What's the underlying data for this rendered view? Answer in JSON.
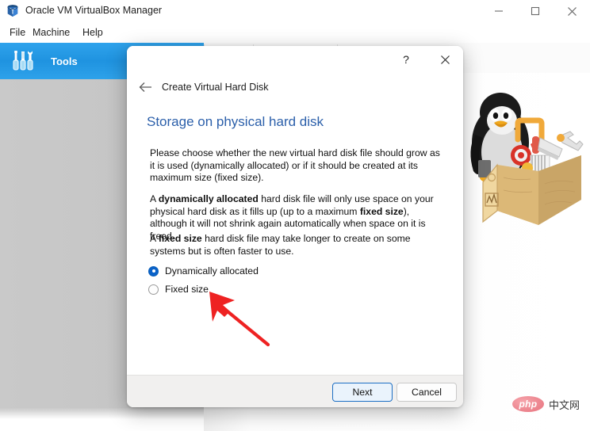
{
  "app": {
    "title": "Oracle VM VirtualBox Manager",
    "logo_icon": "virtualbox-cube-icon",
    "window_controls": {
      "minimize": "minimize-icon",
      "maximize": "maximize-icon",
      "close": "close-icon"
    },
    "menu": [
      {
        "label": "File"
      },
      {
        "label": "Machine"
      },
      {
        "label": "Help"
      }
    ],
    "sidebar": {
      "items": [
        {
          "label": "Tools",
          "icon": "tools-icon",
          "selected": true
        }
      ]
    },
    "toolbar": {
      "icons": [
        "swirl-icon",
        "orange-arc-icon",
        "blue-arc-icon",
        "gray-zigzag-icon",
        "green-square-icon"
      ]
    },
    "mascot": {
      "icon": "tux-penguin-toolbox-icon"
    }
  },
  "dialog": {
    "help_icon": "help-question-icon",
    "close_icon": "close-icon",
    "back_icon": "back-arrow-icon",
    "breadcrumb": "Create Virtual Hard Disk",
    "heading": "Storage on physical hard disk",
    "paragraphs": {
      "p1": "Please choose whether the new virtual hard disk file should grow as it is used (dynamically allocated) or if it should be created at its maximum size (fixed size).",
      "p2_pre": "A ",
      "p2_bold1": "dynamically allocated",
      "p2_mid": " hard disk file will only use space on your physical hard disk as it fills up (up to a maximum ",
      "p2_bold2": "fixed size",
      "p2_post": "), although it will not shrink again automatically when space on it is freed.",
      "p3_pre": "A ",
      "p3_bold": "fixed size",
      "p3_post": " hard disk file may take longer to create on some systems but is often faster to use."
    },
    "options": [
      {
        "label": "Dynamically allocated",
        "selected": true
      },
      {
        "label": "Fixed size",
        "selected": false
      }
    ],
    "buttons": {
      "next": "Next",
      "cancel": "Cancel"
    }
  },
  "annotation": {
    "arrow_icon": "red-arrow-pointer",
    "color": "#ee2222"
  },
  "watermark": {
    "logo_text": "php",
    "text": "中文网"
  },
  "colors": {
    "accent_blue": "#2b5faa",
    "sidebar_selected": "#2199e8",
    "radio_selected": "#0a62c9",
    "dialog_bg": "#ffffff",
    "footer_bg": "#f1f0ef"
  }
}
